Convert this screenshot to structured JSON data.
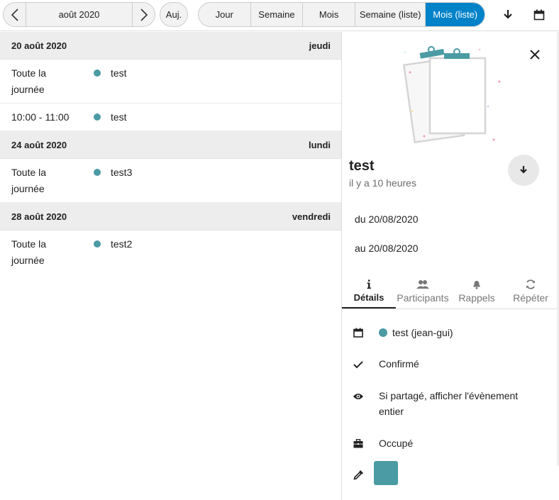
{
  "toolbar": {
    "date_label": "août 2020",
    "today_label": "Auj.",
    "views": [
      {
        "label": "Jour",
        "active": false
      },
      {
        "label": "Semaine",
        "active": false
      },
      {
        "label": "Mois",
        "active": false
      },
      {
        "label": "Semaine (liste)",
        "active": false
      },
      {
        "label": "Mois (liste)",
        "active": true
      }
    ],
    "icons": [
      "chevron-left-icon",
      "chevron-right-icon",
      "download-icon",
      "calendar-icon"
    ]
  },
  "colors": {
    "accent": "#0082c9",
    "event_dot": "#4a9ba4",
    "swatch": "#4a9ba4"
  },
  "list": {
    "days": [
      {
        "date": "20 août 2020",
        "weekday": "jeudi",
        "events": [
          {
            "time_line1": "Toute la",
            "time_line2": "journée",
            "title": "test"
          },
          {
            "time_line1": "10:00 - 11:00",
            "time_line2": "",
            "title": "test"
          }
        ]
      },
      {
        "date": "24 août 2020",
        "weekday": "lundi",
        "events": [
          {
            "time_line1": "Toute la",
            "time_line2": "journée",
            "title": "test3"
          }
        ]
      },
      {
        "date": "28 août 2020",
        "weekday": "vendredi",
        "events": [
          {
            "time_line1": "Toute la",
            "time_line2": "journée",
            "title": "test2"
          }
        ]
      }
    ]
  },
  "panel": {
    "title": "test",
    "ago": "il y a 10 heures",
    "from": "du 20/08/2020",
    "to": "au 20/08/2020",
    "tabs": [
      {
        "label": "Détails",
        "icon": "info-icon",
        "active": true
      },
      {
        "label": "Participants",
        "icon": "people-icon",
        "active": false
      },
      {
        "label": "Rappels",
        "icon": "bell-icon",
        "active": false
      },
      {
        "label": "Répéter",
        "icon": "repeat-icon",
        "active": false
      }
    ],
    "details": {
      "calendar": "test (jean-gui)",
      "status": "Confirmé",
      "visibility": "Si partagé, afficher l'évènement entier",
      "availability": "Occupé"
    }
  }
}
